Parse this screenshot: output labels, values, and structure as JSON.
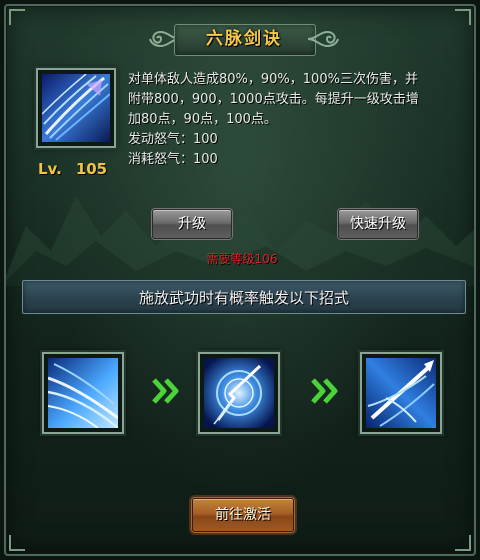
{
  "title": "六脉剑诀",
  "skill": {
    "icon": "sword-slash-icon",
    "level_prefix": "Lv.",
    "level": "105",
    "description_lines": [
      "对单体敌人造成80%，90%，100%三次伤害，并",
      "附带800，900，1000点攻击。每提升一级攻击增",
      "加80点，90点，100点。",
      "发动怒气：100",
      "消耗怒气：100"
    ]
  },
  "buttons": {
    "upgrade": "升级",
    "quick_upgrade": "快速升级",
    "goto_activate": "前往激活"
  },
  "requirement": "需要等级106",
  "chain_bar": "施放武功时有概率触发以下招式",
  "chain": [
    {
      "icon": "blue-wind-icon"
    },
    {
      "icon": "lightning-vortex-icon"
    },
    {
      "icon": "spear-thrust-icon"
    }
  ],
  "colors": {
    "title": "#f5c94a",
    "level": "#f2c443",
    "requirement": "#e02020",
    "arrow": "#4bd43a"
  }
}
